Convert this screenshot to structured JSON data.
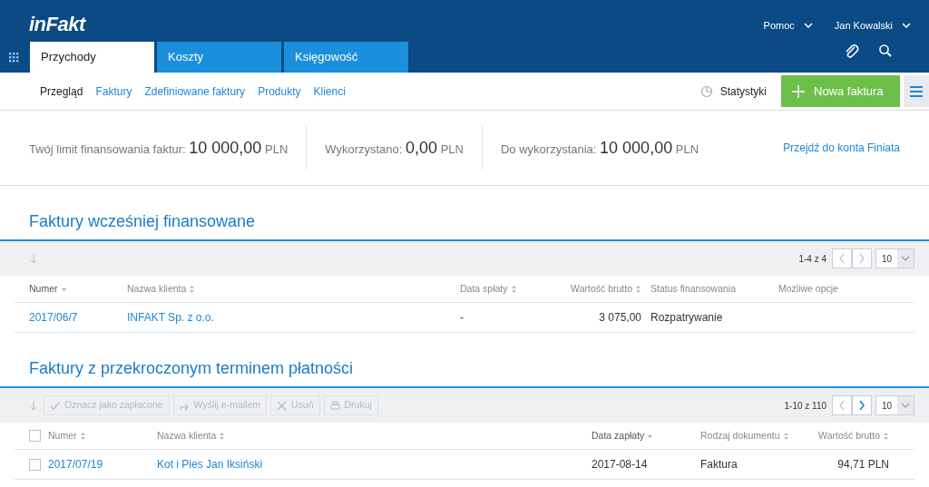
{
  "header": {
    "logo": "inFakt",
    "menus": [
      {
        "label": "Pomoc"
      },
      {
        "label": "Jan Kowalski"
      }
    ],
    "tabs": [
      {
        "label": "Przychody",
        "selected": true
      },
      {
        "label": "Koszty",
        "selected": false
      },
      {
        "label": "Księgowość",
        "selected": false
      }
    ]
  },
  "subnav": {
    "items": [
      {
        "label": "Przegląd",
        "selected": true
      },
      {
        "label": "Faktury",
        "selected": false
      },
      {
        "label": "Zdefiniowane faktury",
        "selected": false
      },
      {
        "label": "Produkty",
        "selected": false
      },
      {
        "label": "Klienci",
        "selected": false
      }
    ],
    "stats": "Statystyki",
    "new_button": "Nowa faktura"
  },
  "limits": {
    "items": [
      {
        "label": "Twój limit finansowania faktur:",
        "value": "10 000,00",
        "unit": "PLN"
      },
      {
        "label": "Wykorzystano:",
        "value": "0,00",
        "unit": "PLN"
      },
      {
        "label": "Do wykorzystania:",
        "value": "10 000,00",
        "unit": "PLN"
      }
    ],
    "link": "Przejdź do konta Finiata"
  },
  "sections": [
    {
      "title": "Faktury wcześniej finansowane",
      "pager": {
        "range": "1-4 z 4",
        "prev_enabled": false,
        "next_enabled": false,
        "per_page": "10"
      },
      "columns": [
        {
          "label": "Numer",
          "sorted": true
        },
        {
          "label": "Nazwa klienta",
          "sorted": false
        },
        {
          "label": "Data spłaty",
          "sorted": false
        },
        {
          "label": "Wartość brutto",
          "sorted": false
        },
        {
          "label": "Status finansowania"
        },
        {
          "label": "Możliwe opcje"
        }
      ],
      "rows": [
        {
          "cells": [
            "2017/06/7",
            "INFAKT Sp. z o.o.",
            "-",
            "3 075,00",
            "Rozpatrywanie"
          ]
        }
      ]
    },
    {
      "title": "Faktury z przekroczonym terminem płatności",
      "all_checked": false,
      "actions": [
        {
          "label": "Oznacz jako zapłacone",
          "kind": "check",
          "disabled": true
        },
        {
          "label": "Wyślij e-mailem",
          "kind": "send",
          "disabled": true
        },
        {
          "label": "Usuń",
          "kind": "delete",
          "disabled": true
        },
        {
          "label": "Drukuj",
          "kind": "print",
          "disabled": true
        }
      ],
      "pager": {
        "range": "1-10 z 110",
        "prev_enabled": false,
        "next_enabled": true,
        "per_page": "10"
      },
      "columns": [
        {
          "label": "Numer",
          "sorted": false
        },
        {
          "label": "Nazwa klienta",
          "sorted": false
        },
        {
          "label": "Data zapłaty",
          "sorted": true
        },
        {
          "label": "Rodzaj dokumentu",
          "sorted": false
        },
        {
          "label": "Wartość brutto",
          "sorted": false
        }
      ],
      "rows": [
        {
          "checked": false,
          "cells": [
            "2017/07/19",
            "Kot i Pies Jan Iksiński",
            "2017-08-14",
            "Faktura",
            "94,71 PLN"
          ]
        }
      ]
    }
  ]
}
